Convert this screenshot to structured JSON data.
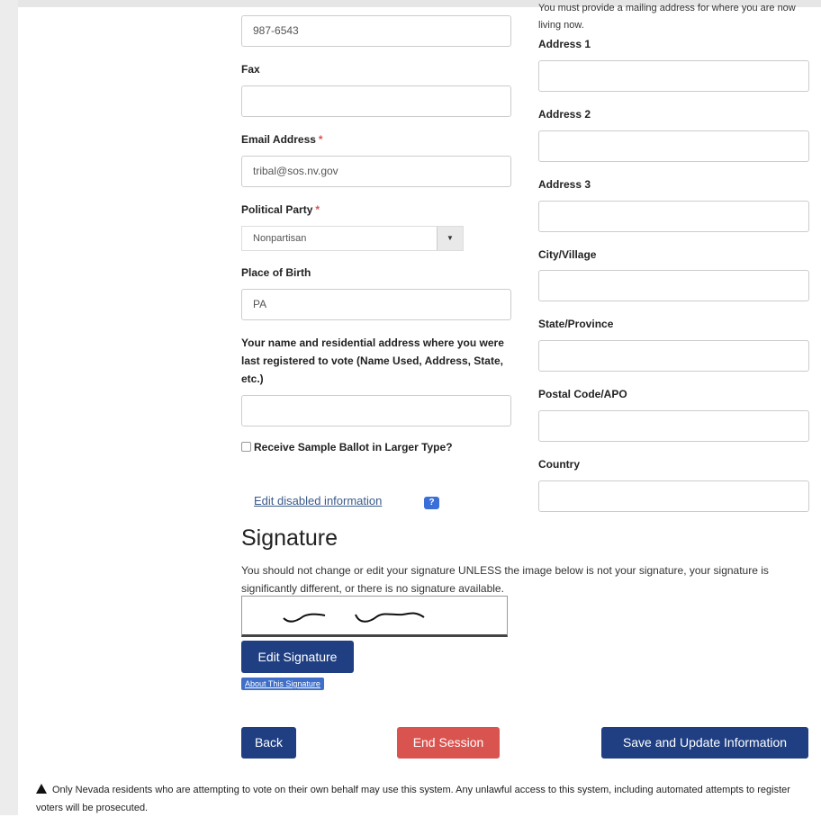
{
  "left_column": {
    "phone_value": "987-6543",
    "fax_label": "Fax",
    "fax_value": "",
    "email_label": "Email Address",
    "email_value": "tribal@sos.nv.gov",
    "required_mark": "*",
    "party_label": "Political Party",
    "party_selected": "Nonpartisan",
    "birth_label": "Place of Birth",
    "birth_value": "PA",
    "last_registered_label": "Your name and residential address where you were last registered to vote (Name Used, Address, State, etc.)",
    "last_registered_value": "",
    "large_ballot_label": "Receive Sample Ballot in Larger Type?",
    "large_ballot_checked": false,
    "edit_disabled_link": "Edit disabled information",
    "help_icon": "?"
  },
  "right_column": {
    "mailing_note": "You must provide a mailing address for where you are now living now.",
    "address1_label": "Address 1",
    "address2_label": "Address 2",
    "address3_label": "Address 3",
    "city_label": "City/Village",
    "state_label": "State/Province",
    "postal_label": "Postal Code/APO",
    "country_label": "Country"
  },
  "signature": {
    "heading": "Signature",
    "instructions": "You should not change or edit your signature UNLESS the image below is not your signature, your signature is significantly different, or there is no signature available.",
    "edit_button": "Edit Signature",
    "about_link": "About This Signature"
  },
  "actions": {
    "back": "Back",
    "end_session": "End Session",
    "save": "Save and Update Information"
  },
  "footer": {
    "warning": "Only Nevada residents who are attempting to vote on their own behalf may use this system. Any unlawful access to this system, including automated attempts to register voters will be prosecuted."
  },
  "colors": {
    "primary_button": "#1f3f82",
    "danger_button": "#d9534f",
    "link": "#3a5a8a"
  }
}
